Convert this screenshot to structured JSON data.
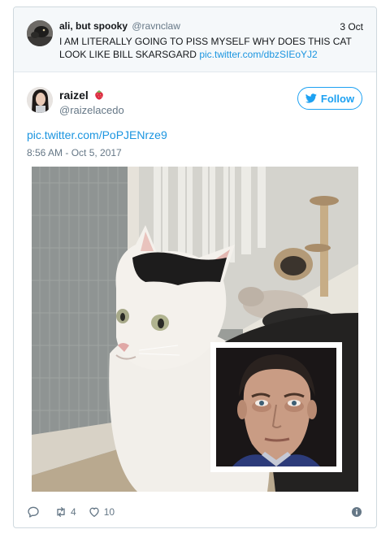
{
  "parent_tweet": {
    "name": "ali, but spooky",
    "handle": "@ravnclaw",
    "date": "3 Oct",
    "text": "I AM LITERALLY GOING TO PISS MYSELF WHY DOES THIS CAT LOOK LIKE BILL SKARSGARD",
    "link": "pic.twitter.com/dbzSIEoYJ2"
  },
  "tweet": {
    "name": "raizel",
    "handle": "@raizelacedo",
    "follow_label": "Follow",
    "link": "pic.twitter.com/PoPJENrze9",
    "timestamp": "8:56 AM - Oct 5, 2017",
    "retweets": "4",
    "likes": "10"
  },
  "icons": {
    "emoji": "strawberry-icon",
    "follow": "twitter-bird-icon",
    "reply": "reply-icon",
    "retweet": "retweet-icon",
    "like": "heart-icon",
    "info": "info-icon"
  },
  "colors": {
    "accent": "#1da1f2",
    "link": "#1b95e0",
    "muted": "#657786"
  }
}
